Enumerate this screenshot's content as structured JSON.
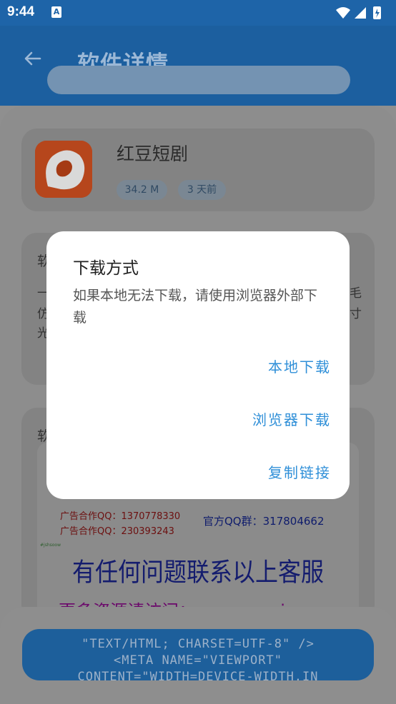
{
  "status_bar": {
    "time": "9:44",
    "notification_letter": "A"
  },
  "header": {
    "title": "软件详情"
  },
  "app": {
    "name": "红豆短剧",
    "size": "34.2 M",
    "updated": "3 天前"
  },
  "background_fragments": {
    "desc_label": "软",
    "desc_line1_left": "一",
    "desc_line1_right": "毛",
    "desc_line2_left": "仿",
    "desc_line2_right": "寸",
    "desc_line3_left": "光",
    "shots_label": "软"
  },
  "screenshot_content": {
    "ad_line1": "广告合作QQ：1370778330",
    "ad_line2": "广告合作QQ：230393243",
    "official_group": "官方QQ群：317804662",
    "tiny_mark": "#jshsoow",
    "support_text": "有任何问题联系以上客服",
    "more_resources": "更多资源请访问：www.ruoyiw.com"
  },
  "bottom_button": {
    "line1": "\"TEXT/HTML; CHARSET=UTF-8\" />",
    "line2": "<META NAME=\"VIEWPORT\"",
    "line3": "CONTENT=\"WIDTH=DEVICE-WIDTH,IN"
  },
  "dialog": {
    "title": "下载方式",
    "message": "如果本地无法下载，请使用浏览器外部下载",
    "buttons": {
      "local": "本地下载",
      "browser": "浏览器下载",
      "copy": "复制链接"
    }
  },
  "colors": {
    "primary": "#1e64a8",
    "dialog_action": "#2f8fd8",
    "scrim": "#8f8f8f"
  }
}
